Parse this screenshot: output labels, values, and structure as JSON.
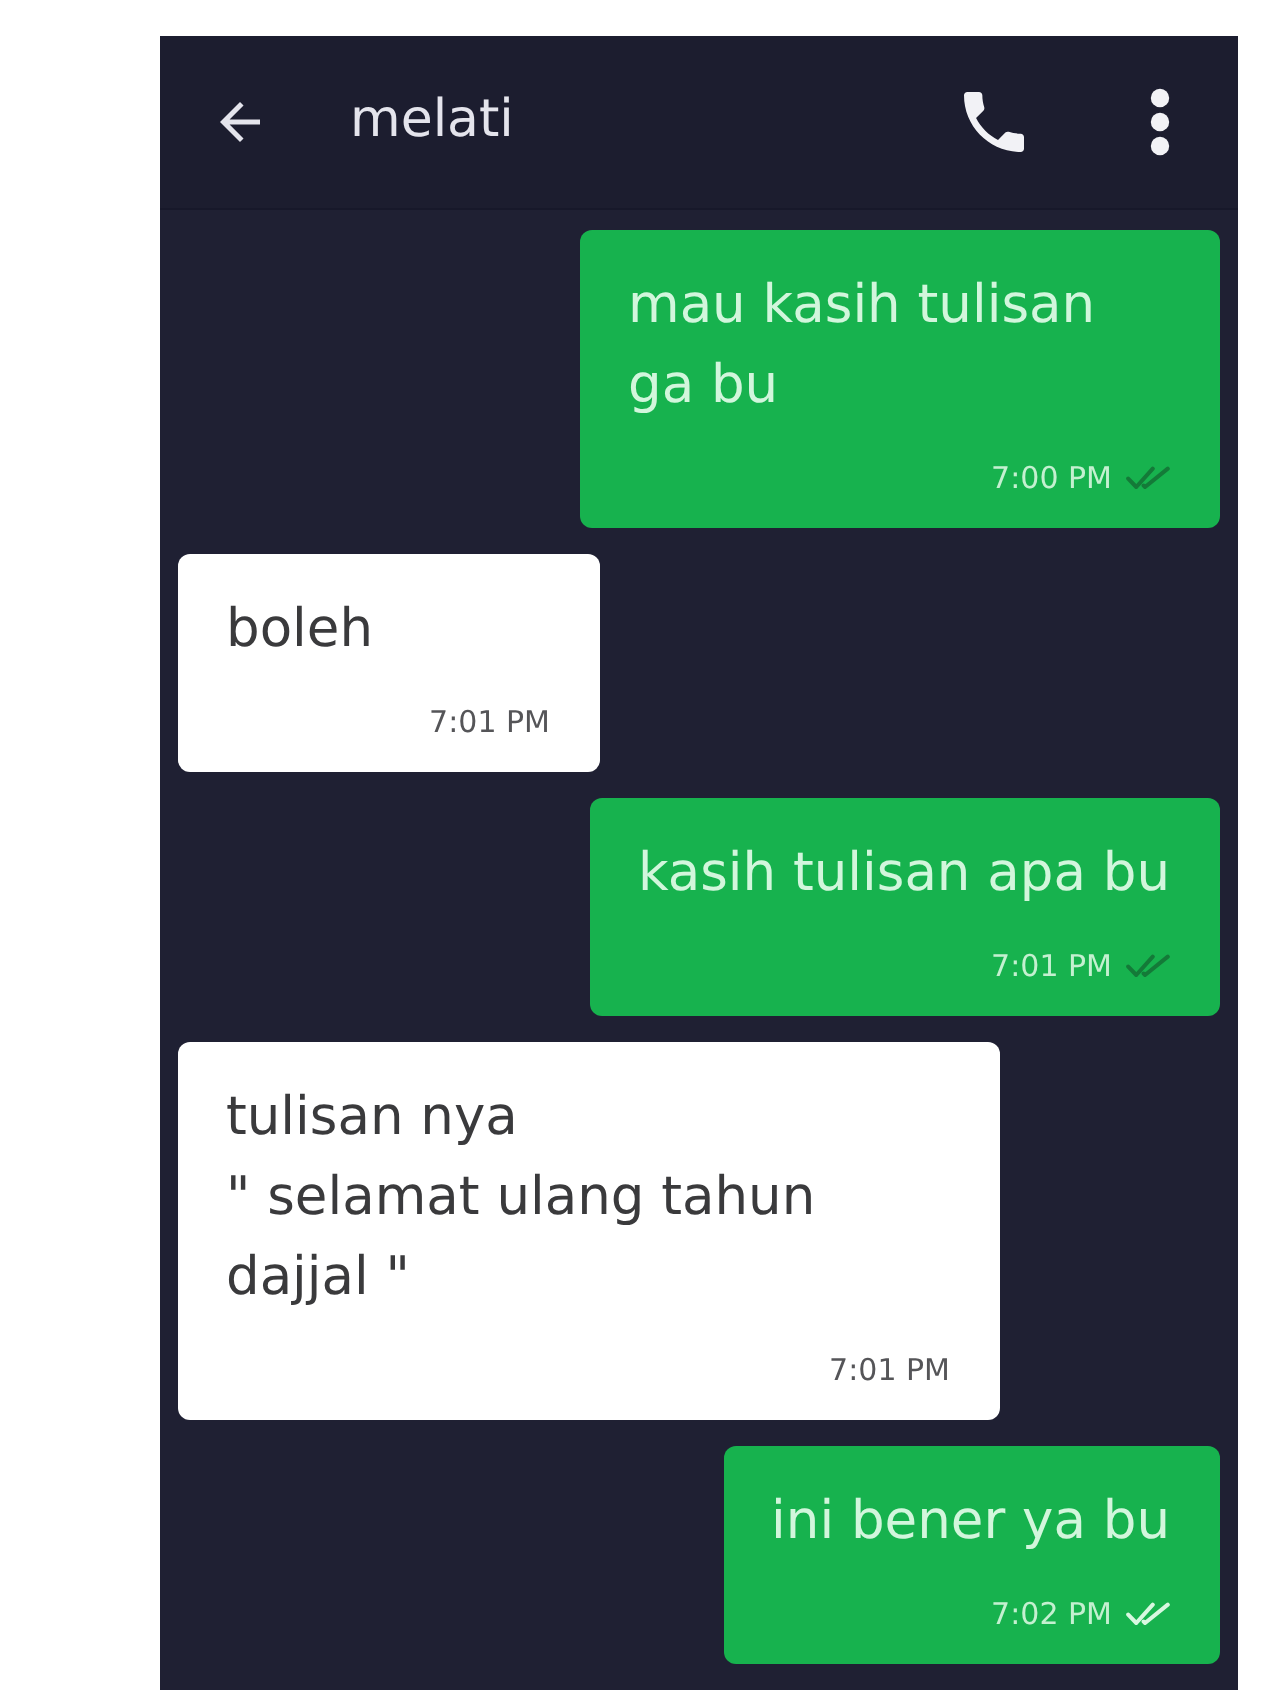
{
  "header": {
    "title": "melati"
  },
  "messages": [
    {
      "kind": "sent",
      "text": "mau kasih tulisan ga bu",
      "time": "7:00 PM",
      "read": false
    },
    {
      "kind": "received",
      "text": "boleh",
      "time": "7:01 PM"
    },
    {
      "kind": "sent",
      "text": "kasih tulisan apa bu",
      "time": "7:01 PM",
      "read": false
    },
    {
      "kind": "received",
      "text": "tulisan nya\n\" selamat ulang tahun dajjal \"",
      "time": "7:01 PM"
    },
    {
      "kind": "sent",
      "text": "ini bener ya bu",
      "time": "7:02 PM",
      "read": true
    }
  ]
}
